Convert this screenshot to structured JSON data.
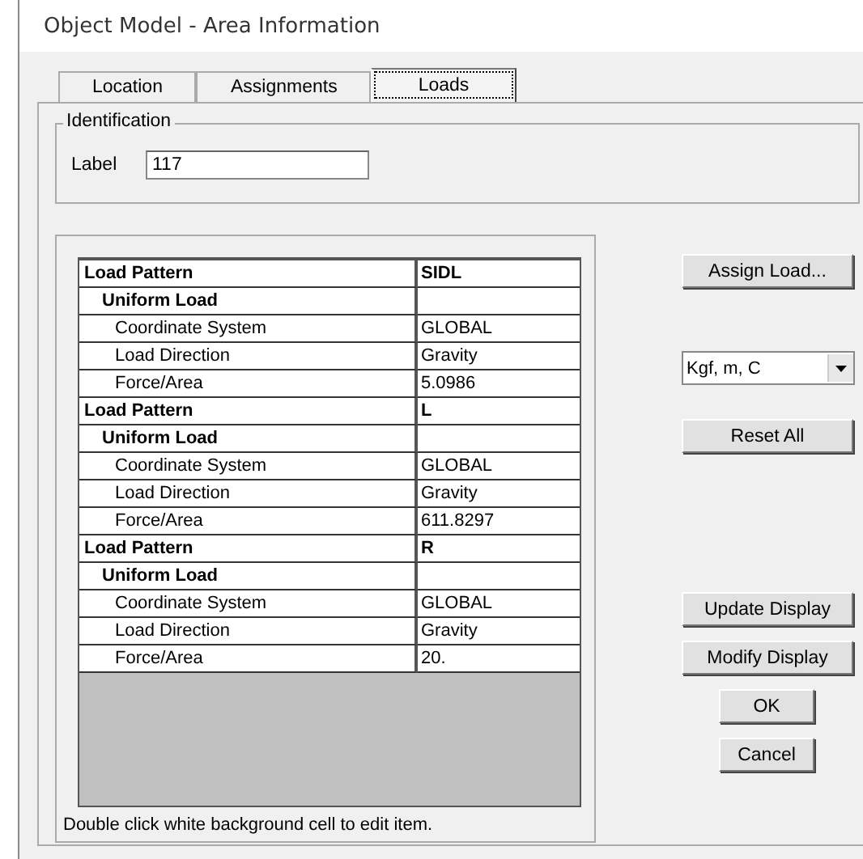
{
  "window": {
    "title": "Object Model - Area Information"
  },
  "tabs": [
    {
      "label": "Location",
      "selected": false
    },
    {
      "label": "Assignments",
      "selected": false
    },
    {
      "label": "Loads",
      "selected": true
    }
  ],
  "identification": {
    "title": "Identification",
    "label": "Label",
    "value": "117"
  },
  "table": {
    "rows": [
      {
        "kind": "pattern",
        "name": "Load Pattern",
        "value": "SIDL"
      },
      {
        "kind": "group",
        "name": "Uniform Load"
      },
      {
        "kind": "property",
        "name": "Coordinate System",
        "value": "GLOBAL"
      },
      {
        "kind": "property",
        "name": "Load Direction",
        "value": "Gravity"
      },
      {
        "kind": "property",
        "name": "Force/Area",
        "value": "5.0986"
      },
      {
        "kind": "pattern",
        "name": "Load Pattern",
        "value": "L"
      },
      {
        "kind": "group",
        "name": "Uniform Load"
      },
      {
        "kind": "property",
        "name": "Coordinate System",
        "value": "GLOBAL"
      },
      {
        "kind": "property",
        "name": "Load Direction",
        "value": "Gravity"
      },
      {
        "kind": "property",
        "name": "Force/Area",
        "value": "611.8297"
      },
      {
        "kind": "pattern",
        "name": "Load Pattern",
        "value": "R"
      },
      {
        "kind": "group",
        "name": "Uniform Load"
      },
      {
        "kind": "property",
        "name": "Coordinate System",
        "value": "GLOBAL"
      },
      {
        "kind": "property",
        "name": "Load Direction",
        "value": "Gravity"
      },
      {
        "kind": "property",
        "name": "Force/Area",
        "value": "20."
      }
    ]
  },
  "hint": "Double click white background cell to edit item.",
  "assign_button": "Assign Load...",
  "units": {
    "value": "Kgf, m, C"
  },
  "reset_button": "Reset All",
  "update_button": "Update Display",
  "modify_button": "Modify Display",
  "ok_button": "OK",
  "cancel_button": "Cancel"
}
